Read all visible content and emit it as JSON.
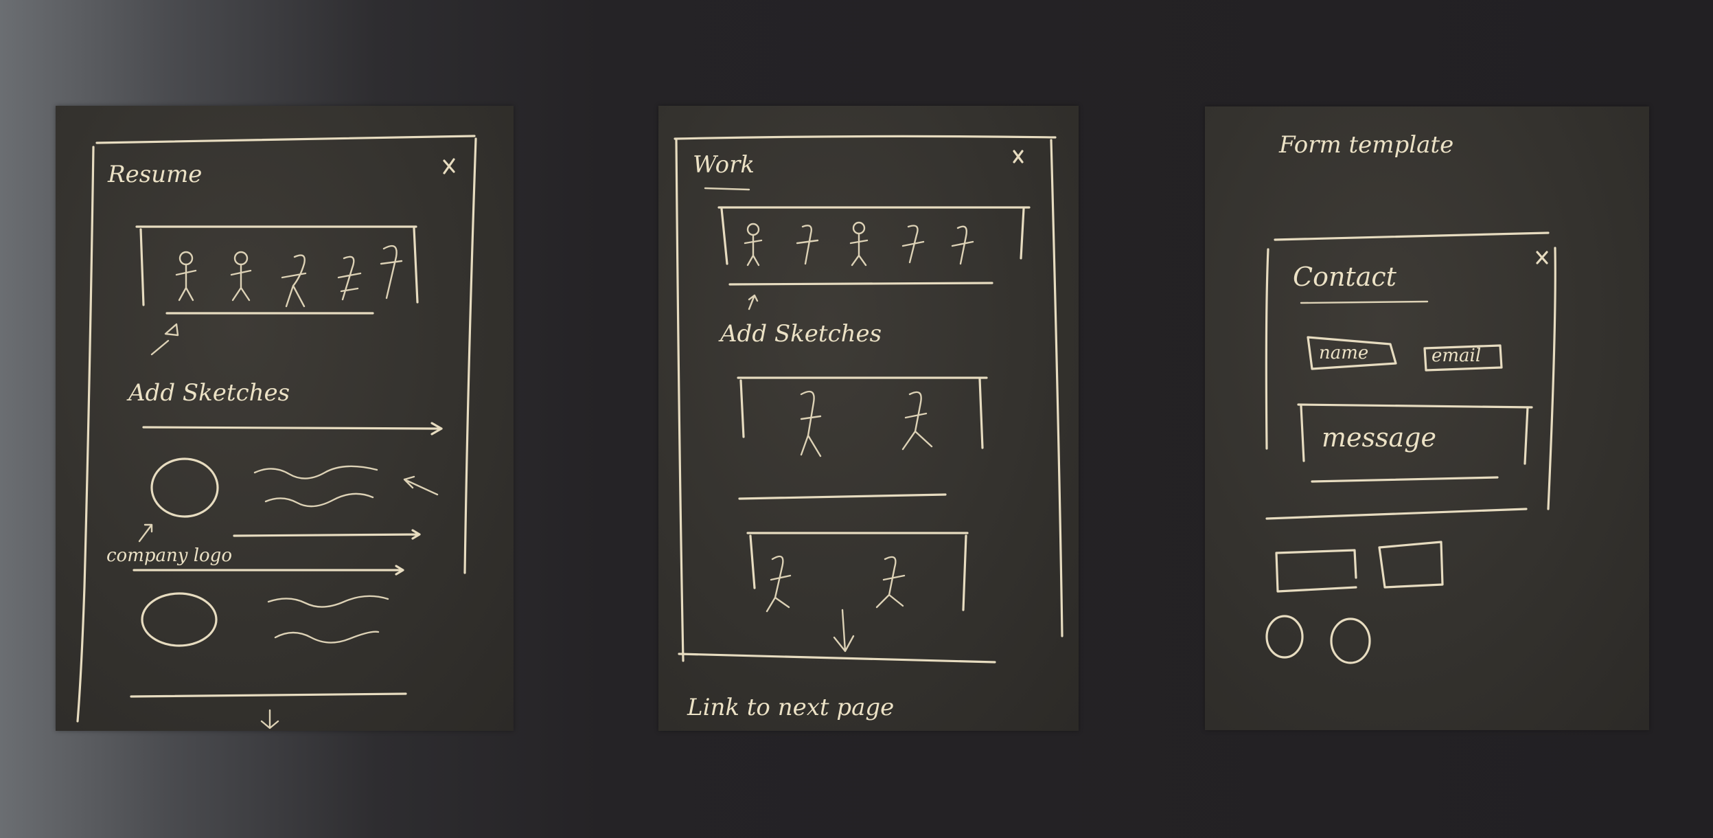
{
  "sketches": [
    {
      "title": "Resume",
      "close_glyph": "x",
      "add_sketches_label": "Add Sketches",
      "company_logo_label": "company logo",
      "side_note_top": "",
      "side_note_mid": ""
    },
    {
      "title": "Work",
      "close_glyph": "x",
      "add_sketches_label": "Add Sketches",
      "link_label": "Link to next page"
    },
    {
      "heading": "Form template",
      "title": "Contact",
      "close_glyph": "x",
      "name_field_label": "name",
      "email_field_label": "email",
      "message_field_label": "message"
    }
  ],
  "colors": {
    "chalk_ink": "#e7dcc0",
    "paper": "#34322e",
    "backdrop": "#222023"
  }
}
